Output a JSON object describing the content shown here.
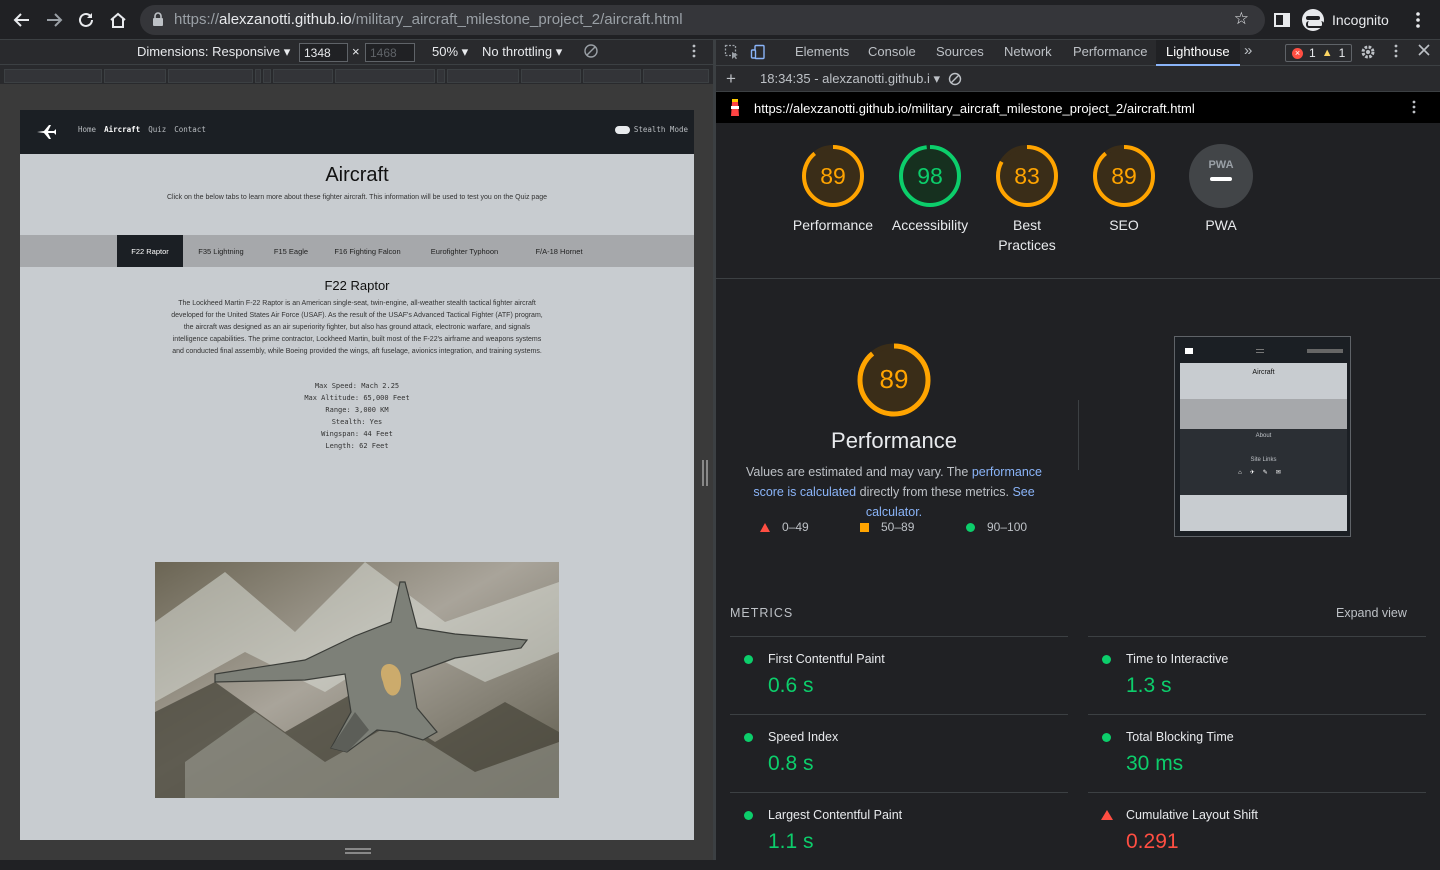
{
  "browser": {
    "url_prefix": "https://",
    "url_host": "alexzanotti.github.io",
    "url_path": "/military_aircraft_milestone_project_2/aircraft.html",
    "profile_label": "Incognito"
  },
  "device_toolbar": {
    "dimensions_label": "Dimensions: Responsive",
    "width": "1348",
    "height_placeholder": "1468",
    "times": "×",
    "zoom": "50%",
    "throttling": "No throttling"
  },
  "site": {
    "nav": {
      "links": [
        "Home",
        "Aircraft",
        "Quiz",
        "Contact"
      ],
      "active": "Aircraft",
      "stealth_label": "Stealth Mode"
    },
    "title": "Aircraft",
    "lead": "Click on the below tabs to learn more about these fighter aircraft. This information will be used to test you on the Quiz page",
    "tabs": [
      "F22 Raptor",
      "F35 Lightning",
      "F15 Eagle",
      "F16 Fighting Falcon",
      "Eurofighter Typhoon",
      "F/A-18 Hornet"
    ],
    "active_tab": "F22 Raptor",
    "aircraft_name": "F22 Raptor",
    "description": "The Lockheed Martin F-22 Raptor is an American single-seat, twin-engine, all-weather stealth tactical fighter aircraft developed for the United States Air Force (USAF). As the result of the USAF's Advanced Tactical Fighter (ATF) program, the aircraft was designed as an air superiority fighter, but also has ground attack, electronic warfare, and signals intelligence capabilities. The prime contractor, Lockheed Martin, built most of the F-22's airframe and weapons systems and conducted final assembly, while Boeing provided the wings, aft fuselage, avionics integration, and training systems.",
    "specs": [
      "Max Speed: Mach 2.25",
      "Max Altitude: 65,000 Feet",
      "Range: 3,000 KM",
      "Stealth: Yes",
      "Wingspan: 44 Feet",
      "Length: 62 Feet"
    ]
  },
  "devtools": {
    "tabs": [
      "Elements",
      "Console",
      "Sources",
      "Network",
      "Performance",
      "Lighthouse"
    ],
    "active_tab": "Lighthouse",
    "more": "»",
    "errors": "1",
    "warnings": "1",
    "report_select": "18:34:35 - alexzanotti.github.i",
    "report_url": "https://alexzanotti.github.io/military_aircraft_milestone_project_2/aircraft.html"
  },
  "lighthouse": {
    "categories": [
      {
        "label": "Performance",
        "score": 89,
        "color": "#ffa400"
      },
      {
        "label": "Accessibility",
        "score": 98,
        "color": "#0cce6b"
      },
      {
        "label": "Best Practices",
        "score": 83,
        "color": "#ffa400"
      },
      {
        "label": "SEO",
        "score": 89,
        "color": "#ffa400"
      },
      {
        "label": "PWA",
        "score": null,
        "color": "#9aa0a6"
      }
    ],
    "pwa_badge": "PWA",
    "perf": {
      "score": "89",
      "title": "Performance",
      "text_pre": "Values are estimated and may vary. The ",
      "link1": "performance score is calculated",
      "text_mid": " directly from these metrics. ",
      "link2": "See calculator."
    },
    "legend": [
      "0–49",
      "50–89",
      "90–100"
    ],
    "metrics_heading": "METRICS",
    "expand": "Expand view",
    "metrics": [
      {
        "name": "First Contentful Paint",
        "value": "0.6 s",
        "status": "pass"
      },
      {
        "name": "Time to Interactive",
        "value": "1.3 s",
        "status": "pass"
      },
      {
        "name": "Speed Index",
        "value": "0.8 s",
        "status": "pass"
      },
      {
        "name": "Total Blocking Time",
        "value": "30 ms",
        "status": "pass"
      },
      {
        "name": "Largest Contentful Paint",
        "value": "1.1 s",
        "status": "pass"
      },
      {
        "name": "Cumulative Layout Shift",
        "value": "0.291",
        "status": "fail"
      }
    ],
    "thumb": {
      "title": "Aircraft",
      "about": "About",
      "site_links": "Site Links"
    },
    "colors": {
      "pass": "#0cce6b",
      "average": "#ffa400",
      "fail": "#ff4e42"
    }
  }
}
